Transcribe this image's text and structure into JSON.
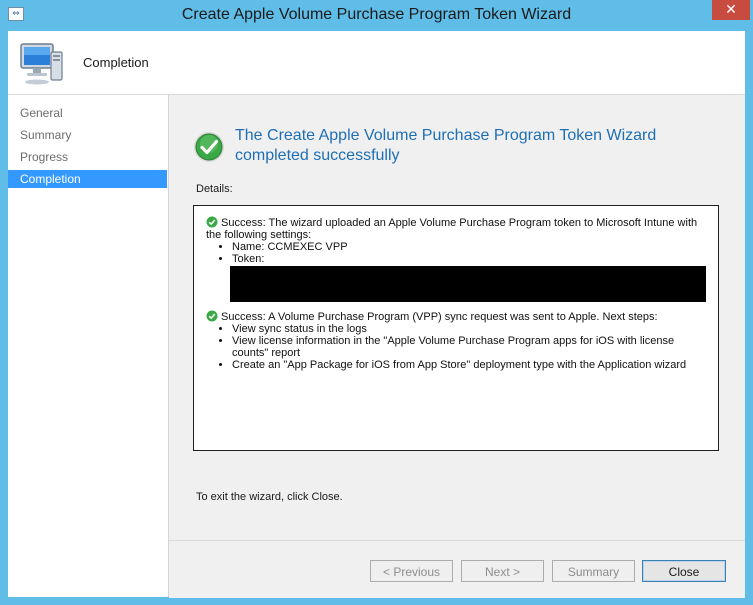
{
  "window": {
    "title": "Create Apple Volume Purchase Program Token Wizard",
    "close_glyph": "✕"
  },
  "header": {
    "title": "Completion",
    "icon": "computer-icon"
  },
  "sidebar": {
    "items": [
      {
        "label": "General",
        "active": false
      },
      {
        "label": "Summary",
        "active": false
      },
      {
        "label": "Progress",
        "active": false
      },
      {
        "label": "Completion",
        "active": true
      }
    ]
  },
  "main": {
    "heading": "The Create Apple Volume Purchase Program Token Wizard completed successfully",
    "details_label": "Details:",
    "details": {
      "block1": {
        "text": "Success: The wizard uploaded an Apple Volume Purchase Program token to Microsoft Intune with the following settings:",
        "items": [
          "Name: CCMEXEC VPP",
          "Token:"
        ]
      },
      "block2": {
        "text": "Success: A Volume Purchase Program (VPP) sync request was sent to Apple. Next steps:",
        "items": [
          "View sync status in the logs",
          "View license information in the \"Apple Volume Purchase Program apps for iOS with license counts\" report",
          "Create an \"App Package for iOS from App Store\" deployment type with the Application wizard"
        ]
      }
    },
    "exit_text": "To exit the wizard, click Close."
  },
  "footer": {
    "previous": "< Previous",
    "next": "Next >",
    "summary": "Summary",
    "close": "Close"
  },
  "colors": {
    "frame": "#5fbde8",
    "heading": "#1f6fb6",
    "active_nav": "#3399ff",
    "close_button": "#c74b3f"
  }
}
